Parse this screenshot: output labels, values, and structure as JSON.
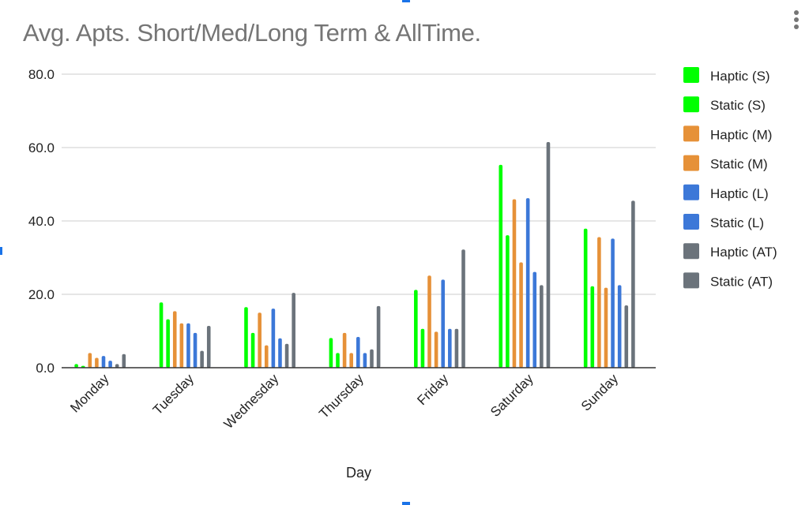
{
  "menu": {
    "icon": "more-vert-icon"
  },
  "chart_data": {
    "type": "bar",
    "title": "Avg. Apts. Short/Med/Long Term & AllTime.",
    "xlabel": "Day",
    "ylabel": "",
    "ylim": [
      0,
      80
    ],
    "yticks": [
      0,
      20,
      40,
      60,
      80
    ],
    "ytick_labels": [
      "0.0",
      "20.0",
      "40.0",
      "60.0",
      "80.0"
    ],
    "grid": true,
    "legend_position": "right",
    "categories": [
      "Monday",
      "Tuesday",
      "Wednesday",
      "Thursday",
      "Friday",
      "Saturday",
      "Sunday"
    ],
    "series": [
      {
        "name": "Haptic (S)",
        "color": "#00ff00",
        "values": [
          1.0,
          17.8,
          16.5,
          8.1,
          21.2,
          55.3,
          37.9
        ]
      },
      {
        "name": "Static (S)",
        "color": "#00ff00",
        "values": [
          0.5,
          13.2,
          9.5,
          4.0,
          10.6,
          36.1,
          22.2
        ]
      },
      {
        "name": "Haptic (M)",
        "color": "#e69138",
        "values": [
          4.0,
          15.4,
          15.0,
          9.5,
          25.1,
          45.9,
          35.6
        ]
      },
      {
        "name": "Static (M)",
        "color": "#e69138",
        "values": [
          2.7,
          12.1,
          6.1,
          4.0,
          9.8,
          28.7,
          21.8
        ]
      },
      {
        "name": "Haptic (L)",
        "color": "#3c78d8",
        "values": [
          3.2,
          12.1,
          16.1,
          8.4,
          24.0,
          46.2,
          35.2
        ]
      },
      {
        "name": "Static (L)",
        "color": "#3c78d8",
        "values": [
          1.9,
          9.5,
          8.0,
          4.0,
          10.6,
          26.1,
          22.5
        ]
      },
      {
        "name": "Haptic (AT)",
        "color": "#6b737b",
        "values": [
          1.0,
          4.6,
          6.5,
          5.0,
          10.6,
          22.5,
          17.0
        ]
      },
      {
        "name": "Static (AT)",
        "color": "#6b737b",
        "values": [
          3.7,
          11.4,
          20.4,
          16.8,
          32.2,
          61.5,
          45.5
        ]
      }
    ]
  }
}
